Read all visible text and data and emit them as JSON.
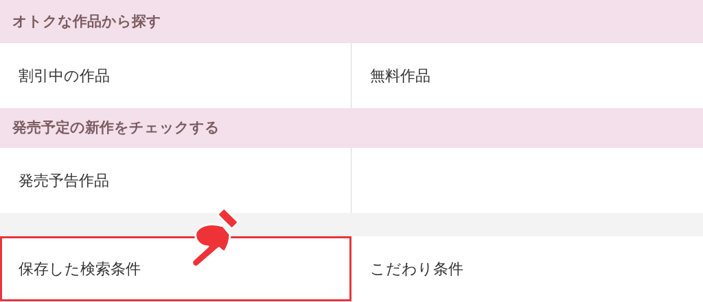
{
  "sections": [
    {
      "heading": "オトクな作品から探す",
      "items": [
        {
          "label": "割引中の作品",
          "highlighted": false
        },
        {
          "label": "無料作品",
          "highlighted": false
        }
      ]
    },
    {
      "heading": "発売予定の新作をチェックする",
      "items": [
        {
          "label": "発売予告作品",
          "highlighted": false
        }
      ]
    },
    {
      "items": [
        {
          "label": "保存した検索条件",
          "highlighted": true
        },
        {
          "label": "こだわり条件",
          "highlighted": false
        }
      ]
    }
  ]
}
